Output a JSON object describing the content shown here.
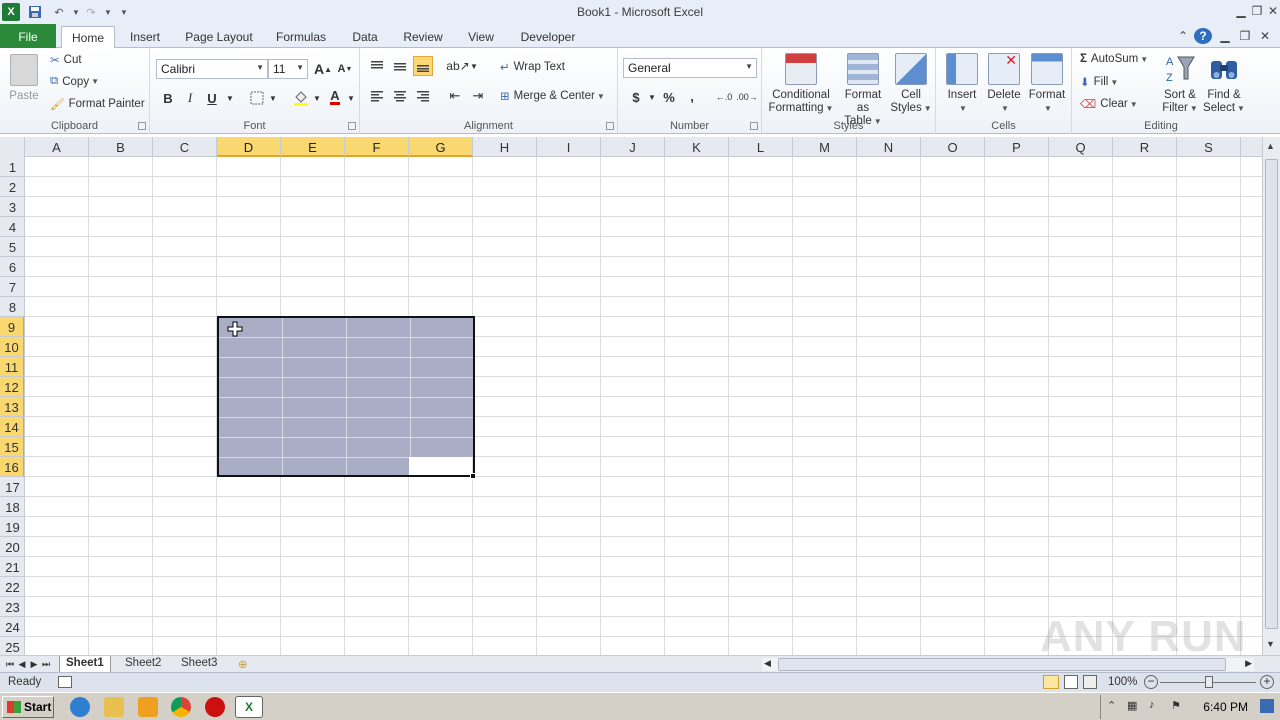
{
  "window": {
    "title": "Book1 - Microsoft Excel"
  },
  "qat": {
    "app_icon": "excel-icon",
    "save_icon": "save-icon",
    "undo_icon": "undo-icon",
    "redo_icon": "redo-icon",
    "customize_icon": "chevron-down-icon"
  },
  "ribbon_tabs": [
    "File",
    "Home",
    "Insert",
    "Page Layout",
    "Formulas",
    "Data",
    "Review",
    "View",
    "Developer"
  ],
  "active_tab": "Home",
  "clipboard": {
    "paste": "Paste",
    "cut": "Cut",
    "copy": "Copy",
    "format_painter": "Format Painter",
    "label": "Clipboard"
  },
  "font": {
    "family": "Calibri",
    "size": "11",
    "bold": "B",
    "italic": "I",
    "underline": "U",
    "grow": "A",
    "shrink": "A",
    "font_color": "A",
    "label": "Font"
  },
  "alignment": {
    "wrap_text": "Wrap Text",
    "merge_center": "Merge & Center",
    "label": "Alignment"
  },
  "number": {
    "format": "General",
    "currency": "$",
    "percent": "%",
    "comma": ",",
    "label": "Number"
  },
  "styles": {
    "conditional_1": "Conditional",
    "conditional_2": "Formatting",
    "table_1": "Format",
    "table_2": "as Table",
    "cell_1": "Cell",
    "cell_2": "Styles",
    "label": "Styles"
  },
  "cells": {
    "insert": "Insert",
    "delete": "Delete",
    "format": "Format",
    "label": "Cells"
  },
  "editing": {
    "autosum": "AutoSum",
    "fill": "Fill",
    "clear": "Clear",
    "sort_1": "Sort &",
    "sort_2": "Filter",
    "find_1": "Find &",
    "find_2": "Select",
    "sigma": "Σ",
    "label": "Editing"
  },
  "columns": [
    "A",
    "B",
    "C",
    "D",
    "E",
    "F",
    "G",
    "H",
    "I",
    "J",
    "K",
    "L",
    "M",
    "N",
    "O",
    "P",
    "Q",
    "R",
    "S"
  ],
  "selected_columns": [
    "D",
    "E",
    "F",
    "G"
  ],
  "rows": [
    "1",
    "2",
    "3",
    "4",
    "5",
    "6",
    "7",
    "8",
    "9",
    "10",
    "11",
    "12",
    "13",
    "14",
    "15",
    "16",
    "17",
    "18",
    "19",
    "20",
    "21",
    "22",
    "23",
    "24",
    "25"
  ],
  "selected_rows": [
    "9",
    "10",
    "11",
    "12",
    "13",
    "14",
    "15",
    "16"
  ],
  "sheets": [
    "Sheet1",
    "Sheet2",
    "Sheet3"
  ],
  "active_sheet": "Sheet1",
  "status": {
    "ready": "Ready",
    "zoom": "100%"
  },
  "taskbar": {
    "start": "Start",
    "clock": "6:40 PM"
  },
  "watermark": "ANY RUN",
  "colors": {
    "file_tab": "#2a8a3a",
    "selection_fill": "#a9adc6",
    "header_highlight": "#f9d870"
  }
}
